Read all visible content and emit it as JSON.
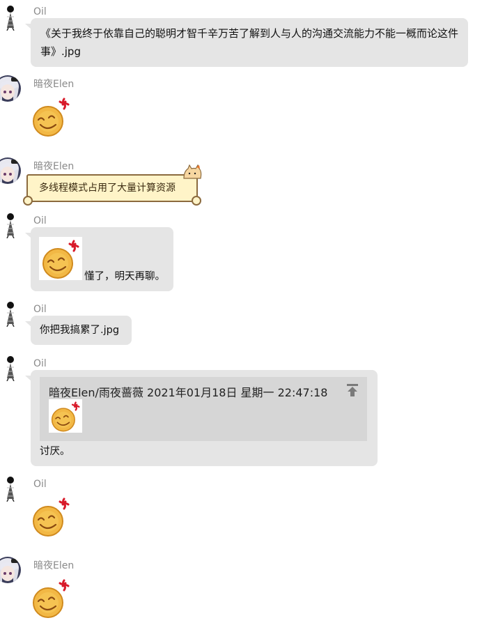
{
  "messages": [
    {
      "sender": "Oil",
      "text": "《关于我终于依靠自己的聪明才智千辛万苦了解到人与人的沟通交流能力不能一概而论这件事》.jpg"
    },
    {
      "sender": "暗夜Elen",
      "emoji": "angry-smile-emoji"
    },
    {
      "sender": "暗夜Elen",
      "card_text": "多线程模式占用了大量计算资源"
    },
    {
      "sender": "Oil",
      "text": "懂了，明天再聊。",
      "emoji": "angry-smile-emoji"
    },
    {
      "sender": "Oil",
      "text": "你把我搞累了.jpg"
    },
    {
      "sender": "Oil",
      "reply": {
        "header": "暗夜Elen/雨夜蔷薇  2021年01月18日 星期一 22:47:18",
        "emoji": "angry-smile-emoji"
      },
      "text": "讨厌。"
    },
    {
      "sender": "Oil",
      "emoji": "angry-smile-emoji"
    },
    {
      "sender": "暗夜Elen",
      "emoji": "angry-smile-emoji"
    }
  ],
  "colors": {
    "bubble": "#e5e5e5",
    "name": "#8a8a8a",
    "card_bg": "#fff4c8",
    "card_border": "#8b6a3e",
    "reply_bg": "#d6d6d6"
  }
}
